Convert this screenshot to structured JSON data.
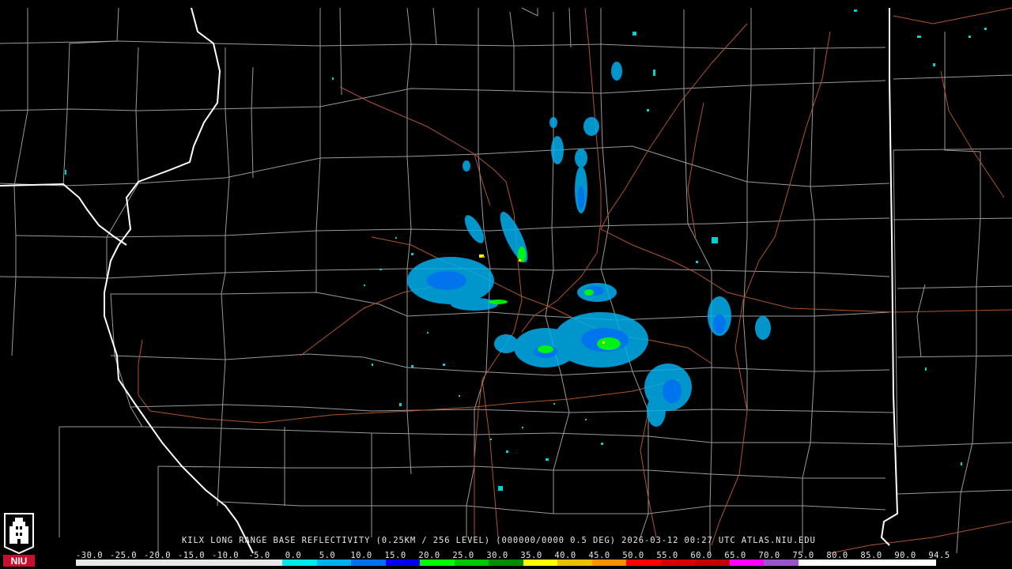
{
  "product": {
    "station": "KILX",
    "title": "LONG RANGE BASE REFLECTIVITY",
    "resolution": "(0.25KM / 256 LEVEL)",
    "volume": "(000000/0000 0.5 DEG)",
    "timestamp": "2026-03-12 00:27 UTC",
    "source": "ATLAS.NIU.EDU"
  },
  "logo": {
    "text": "NIU",
    "color": "#c8102e"
  },
  "scale": {
    "unit_labels": [
      "-30.0",
      "-25.0",
      "-20.0",
      "-15.0",
      "-10.0",
      "-5.0",
      "0.0",
      "5.0",
      "10.0",
      "15.0",
      "20.0",
      "25.0",
      "30.0",
      "35.0",
      "40.0",
      "45.0",
      "50.0",
      "55.0",
      "60.0",
      "65.0",
      "70.0",
      "75.0",
      "80.0",
      "85.0",
      "90.0",
      "94.5"
    ],
    "colors": [
      "#e8e8e8",
      "#e8e8e8",
      "#e8e8e8",
      "#e8e8e8",
      "#e8e8e8",
      "#e8e8e8",
      "#00e8e8",
      "#00b0f0",
      "#0070f0",
      "#0000f0",
      "#00ff00",
      "#00c800",
      "#008c00",
      "#ffff00",
      "#e8c000",
      "#ff9000",
      "#ff0000",
      "#d60000",
      "#c00000",
      "#ff00ff",
      "#9955c9",
      "#ffffff",
      "#ffffff",
      "#ffffff",
      "#ffffff"
    ]
  },
  "map_colors": {
    "background": "#000000",
    "state_border": "#ffffff",
    "county_border": "#9a9a9a",
    "highway": "#b0552a"
  }
}
